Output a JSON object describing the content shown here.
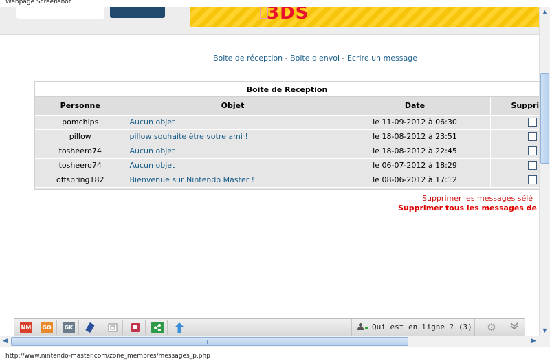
{
  "window": {
    "title": "Webpage Screenshot"
  },
  "header": {
    "banner_text": "3DS"
  },
  "nav": {
    "inbox": "Boite de réception",
    "sep1": " - ",
    "outbox": "Boite d'envoi",
    "sep2": " - ",
    "compose": "Ecrire un message"
  },
  "inbox": {
    "title": "Boite de Reception",
    "columns": [
      "Personne",
      "Objet",
      "Date",
      "Supprimer"
    ],
    "rows": [
      {
        "person": "pomchips",
        "subject": "Aucun objet",
        "date": "le 11-09-2012 à 06:30"
      },
      {
        "person": "pillow",
        "subject": "pillow souhaite être votre ami !",
        "date": "le 18-08-2012 à 23:51"
      },
      {
        "person": "tosheero74",
        "subject": "Aucun objet",
        "date": "le 18-08-2012 à 22:45"
      },
      {
        "person": "tosheero74",
        "subject": "Aucun objet",
        "date": "le 06-07-2012 à 18:29"
      },
      {
        "person": "offspring182",
        "subject": "Bienvenue sur Nintendo Master !",
        "date": "le 08-06-2012 à 17:12"
      }
    ],
    "delete_selected": "Supprimer les messages sélé",
    "delete_all": "Supprimer tous les messages de ce"
  },
  "toolbar": {
    "icons": [
      {
        "name": "nm-icon",
        "text": "NM",
        "color": "#d9412c"
      },
      {
        "name": "go-icon",
        "text": "GO",
        "color": "#e98a2a"
      },
      {
        "name": "gk-icon",
        "text": "GK",
        "color": "#6c7c8c"
      },
      {
        "name": "wiiu-icon",
        "text": "",
        "color": "#2a4f9c"
      },
      {
        "name": "window-icon",
        "text": "",
        "color": "#b0b0b0"
      },
      {
        "name": "save-icon",
        "text": "",
        "color": "#c0354a"
      },
      {
        "name": "share-icon",
        "text": "",
        "color": "#2f9a4a"
      },
      {
        "name": "up-arrow-icon",
        "text": "",
        "color": "#3a8fd8"
      }
    ],
    "online_label": "Qui est en ligne ? (3)"
  },
  "status": {
    "url": "http://www.nintendo-master.com/zone_membres/messages_p.php"
  }
}
